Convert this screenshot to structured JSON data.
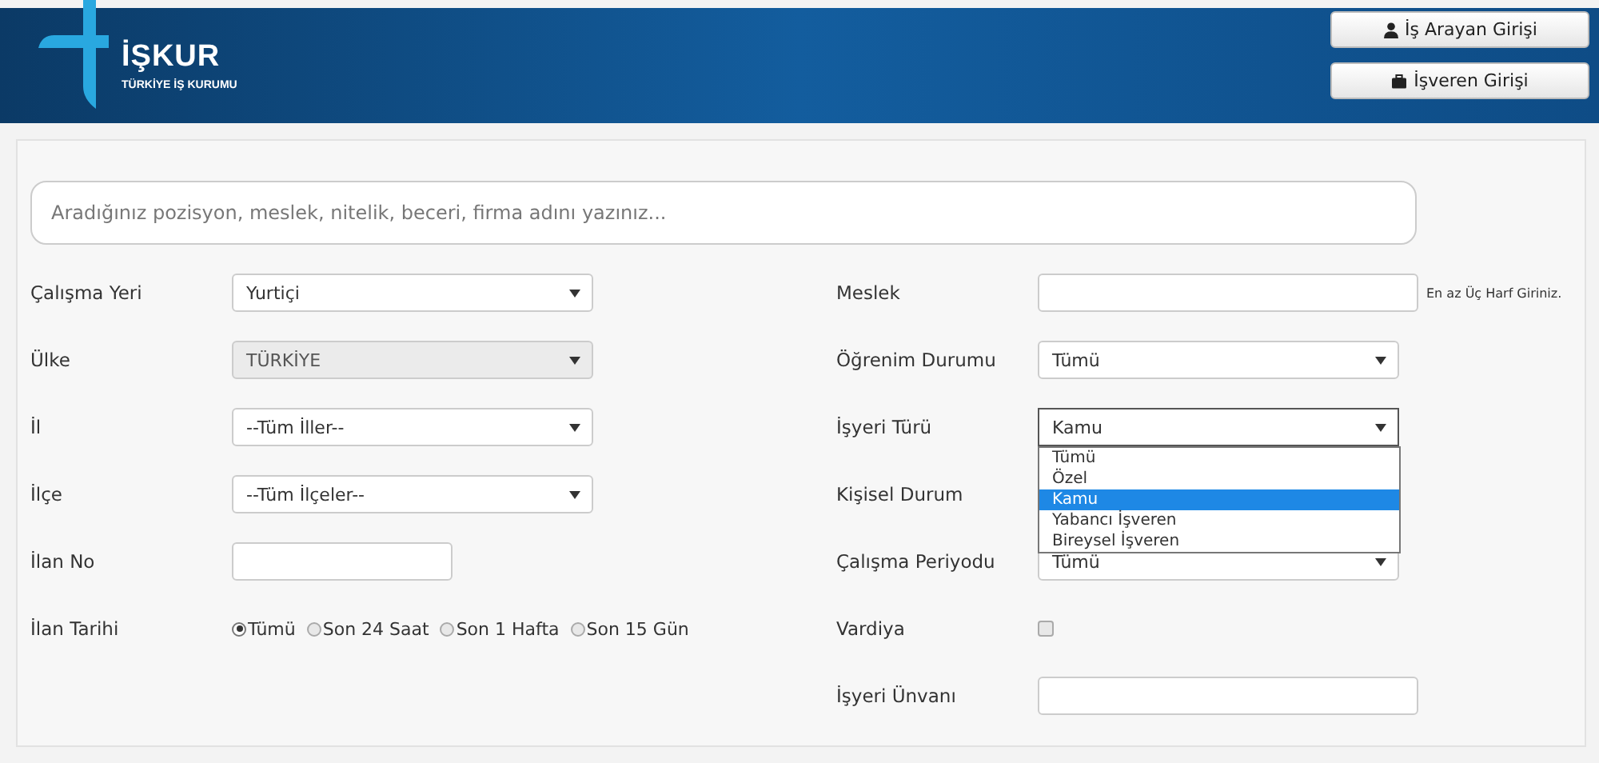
{
  "header": {
    "logo": {
      "title": "İŞKUR",
      "subtitle": "TÜRKİYE İŞ KURUMU"
    },
    "buttons": [
      {
        "label": "İş Arayan Girişi",
        "kind": "user"
      },
      {
        "label": "İşveren Girişi",
        "kind": "briefcase"
      }
    ]
  },
  "search": {
    "placeholder": "Aradığınız pozisyon, meslek, nitelik, beceri, firma adını yazınız..."
  },
  "left_fields": [
    {
      "label": "Çalışma Yeri",
      "kind": "select",
      "value": "Yurtiçi",
      "disabled": false,
      "expanded": false
    },
    {
      "label": "Ülke",
      "kind": "select",
      "value": "TÜRKİYE",
      "disabled": true,
      "expanded": false
    },
    {
      "label": "İl",
      "kind": "select",
      "value": "--Tüm İller--",
      "disabled": false,
      "expanded": false
    },
    {
      "label": "İlçe",
      "kind": "select",
      "value": "--Tüm İlçeler--",
      "disabled": false,
      "expanded": false
    },
    {
      "label": "İlan No",
      "kind": "text"
    },
    {
      "label": "İlan Tarihi",
      "kind": "radio",
      "options": [
        {
          "label": "Tümü",
          "selected": true
        },
        {
          "label": "Son 24 Saat",
          "selected": false
        },
        {
          "label": "Son 1 Hafta",
          "selected": false
        },
        {
          "label": "Son 15 Gün",
          "selected": false
        }
      ]
    }
  ],
  "right_fields": [
    {
      "label": "Meslek",
      "kind": "text",
      "hint": "En az Üç Harf Giriniz."
    },
    {
      "label": "Öğrenim Durumu",
      "kind": "select",
      "value": "Tümü",
      "disabled": false,
      "expanded": false
    },
    {
      "label": "İşyeri Türü",
      "kind": "select",
      "value": "Kamu",
      "disabled": false,
      "expanded": true,
      "options": [
        {
          "label": "Tümü",
          "selected": false
        },
        {
          "label": "Özel",
          "selected": false
        },
        {
          "label": "Kamu",
          "selected": true
        },
        {
          "label": "Yabancı İşveren",
          "selected": false
        },
        {
          "label": "Bireysel İşveren",
          "selected": false
        }
      ]
    },
    {
      "label": "Kişisel Durum",
      "kind": "covered"
    },
    {
      "label": "Çalışma Periyodu",
      "kind": "select",
      "value": "Tümü",
      "disabled": false,
      "expanded": false
    },
    {
      "label": "Vardiya",
      "kind": "checkbox",
      "checked": false
    },
    {
      "label": "İşyeri Ünvanı",
      "kind": "text"
    }
  ]
}
